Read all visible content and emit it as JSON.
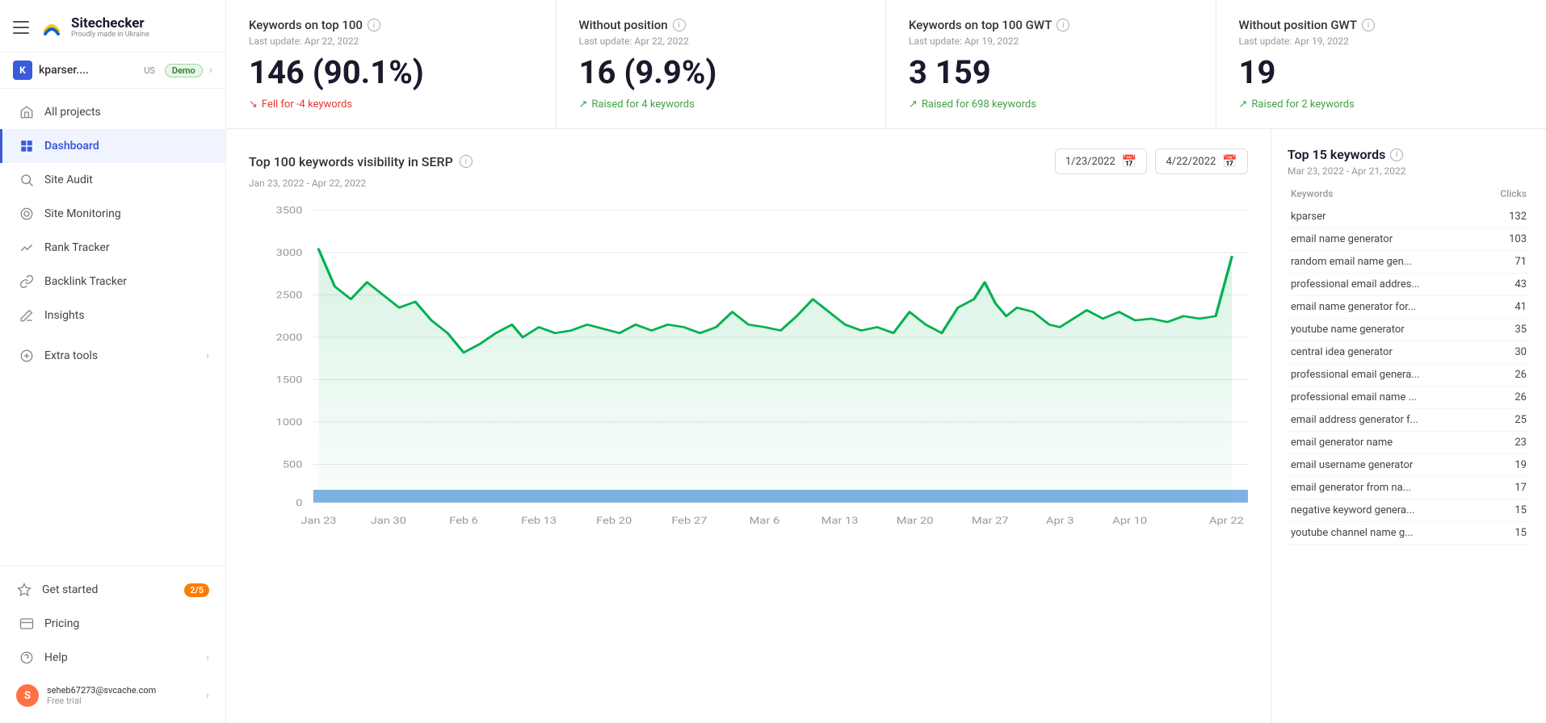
{
  "sidebar": {
    "hamburger_label": "menu",
    "logo_title": "Sitechecker",
    "logo_subtitle": "Proudly made in Ukraine",
    "project": {
      "letter": "K",
      "name": "kparser....",
      "flag": "US",
      "badge": "Demo"
    },
    "nav_items": [
      {
        "id": "all-projects",
        "label": "All projects",
        "icon": "🏠"
      },
      {
        "id": "dashboard",
        "label": "Dashboard",
        "icon": "🔷",
        "active": true
      },
      {
        "id": "site-audit",
        "label": "Site Audit",
        "icon": "◎"
      },
      {
        "id": "site-monitoring",
        "label": "Site Monitoring",
        "icon": "◉"
      },
      {
        "id": "rank-tracker",
        "label": "Rank Tracker",
        "icon": "〰"
      },
      {
        "id": "backlink-tracker",
        "label": "Backlink Tracker",
        "icon": "🔗"
      },
      {
        "id": "insights",
        "label": "Insights",
        "icon": "✏"
      }
    ],
    "extra_tools": {
      "label": "Extra tools",
      "icon": "⊕"
    },
    "get_started": {
      "label": "Get started",
      "badge": "2/5",
      "icon": "◇"
    },
    "pricing": {
      "label": "Pricing",
      "icon": "▣"
    },
    "help": {
      "label": "Help",
      "icon": "?"
    },
    "user": {
      "letter": "S",
      "email": "seheb67273@svcache.com",
      "plan": "Free trial"
    }
  },
  "stat_cards": [
    {
      "title": "Keywords on top 100",
      "last_update": "Last update: Apr 22, 2022",
      "value": "146 (90.1%)",
      "change_type": "down",
      "change_text": "Fell for -4 keywords"
    },
    {
      "title": "Without position",
      "last_update": "Last update: Apr 22, 2022",
      "value": "16 (9.9%)",
      "change_type": "up",
      "change_text": "Raised for 4 keywords"
    },
    {
      "title": "Keywords on top 100 GWT",
      "last_update": "Last update: Apr 19, 2022",
      "value": "3 159",
      "change_type": "up",
      "change_text": "Raised for 698 keywords"
    },
    {
      "title": "Without position GWT",
      "last_update": "Last update: Apr 19, 2022",
      "value": "19",
      "change_type": "up",
      "change_text": "Raised for 2 keywords"
    }
  ],
  "chart": {
    "title": "Top 100 keywords visibility in SERP",
    "date_range": "Jan 23, 2022 - Apr 22, 2022",
    "date_from": "1/23/2022",
    "date_to": "4/22/2022",
    "x_labels": [
      "Jan 23",
      "Jan 30",
      "Feb 6",
      "Feb 13",
      "Feb 20",
      "Feb 27",
      "Mar 6",
      "Mar 13",
      "Mar 20",
      "Mar 27",
      "Apr 3",
      "Apr 10",
      "Apr 22"
    ],
    "y_labels": [
      "0",
      "500",
      "1000",
      "1500",
      "2000",
      "2500",
      "3000",
      "3500"
    ]
  },
  "keywords_panel": {
    "title": "Top 15 keywords",
    "date_range": "Mar 23, 2022 - Apr 21, 2022",
    "col_keywords": "Keywords",
    "col_clicks": "Clicks",
    "keywords": [
      {
        "name": "kparser",
        "clicks": 132
      },
      {
        "name": "email name generator",
        "clicks": 103
      },
      {
        "name": "random email name gen...",
        "clicks": 71
      },
      {
        "name": "professional email addres...",
        "clicks": 43
      },
      {
        "name": "email name generator for...",
        "clicks": 41
      },
      {
        "name": "youtube name generator",
        "clicks": 35
      },
      {
        "name": "central idea generator",
        "clicks": 30
      },
      {
        "name": "professional email genera...",
        "clicks": 26
      },
      {
        "name": "professional email name ...",
        "clicks": 26
      },
      {
        "name": "email address generator f...",
        "clicks": 25
      },
      {
        "name": "email generator name",
        "clicks": 23
      },
      {
        "name": "email username generator",
        "clicks": 19
      },
      {
        "name": "email generator from na...",
        "clicks": 17
      },
      {
        "name": "negative keyword genera...",
        "clicks": 15
      },
      {
        "name": "youtube channel name g...",
        "clicks": 15
      }
    ]
  }
}
